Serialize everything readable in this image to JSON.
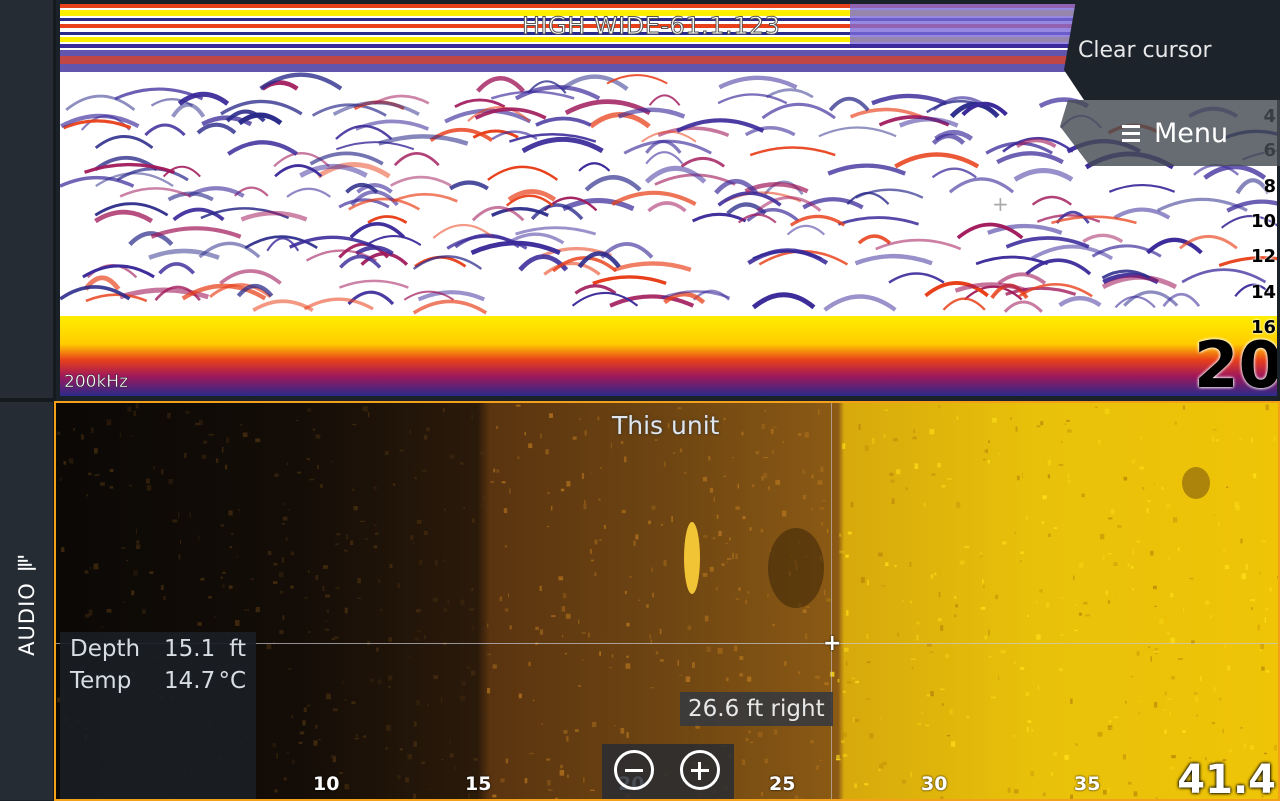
{
  "sidebar": {
    "audio_label": "AUDIO"
  },
  "sonar": {
    "title": "HIGH WIDE-61.1.123",
    "frequency": "200kHz",
    "depth_ticks": [
      "4",
      "6",
      "8",
      "10",
      "12",
      "14",
      "16"
    ],
    "range_value": "20"
  },
  "controls": {
    "clear_cursor_label": "Clear cursor",
    "menu_label": "Menu"
  },
  "sidescan": {
    "unit_label": "This unit",
    "cursor_distance": "26.6 ft right",
    "info": {
      "depth_label": "Depth",
      "depth_value": "15.1",
      "depth_unit": "ft",
      "temp_label": "Temp",
      "temp_value": "14.7",
      "temp_unit": "°C"
    },
    "range_ticks": [
      "10",
      "15",
      "20",
      "25",
      "30",
      "35"
    ],
    "range_value": "41.4"
  },
  "colors": {
    "accent_border": "#f3a01a",
    "sonar_strong": "#ffee00",
    "sonar_medium": "#e8401a",
    "sonar_weak": "#3a2a9a",
    "panel_bg": "#1c232b"
  },
  "icons": [
    "audio-bars-icon",
    "menu-icon",
    "zoom-out-icon",
    "zoom-in-icon",
    "crosshair-icon"
  ]
}
